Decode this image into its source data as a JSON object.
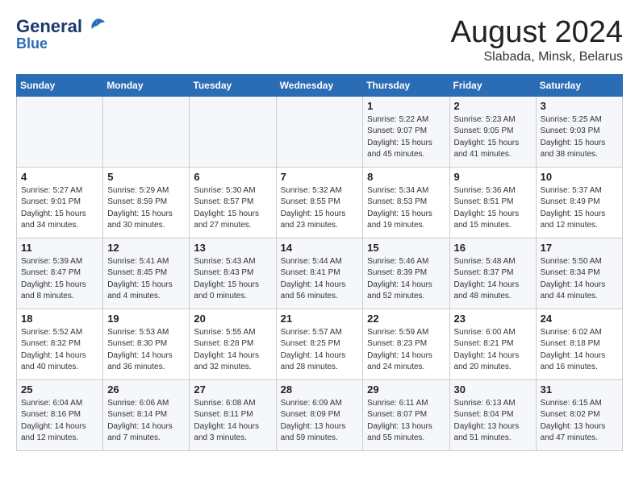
{
  "header": {
    "logo_line1": "General",
    "logo_line2": "Blue",
    "title": "August 2024",
    "subtitle": "Slabada, Minsk, Belarus"
  },
  "days_of_week": [
    "Sunday",
    "Monday",
    "Tuesday",
    "Wednesday",
    "Thursday",
    "Friday",
    "Saturday"
  ],
  "weeks": [
    [
      {
        "num": "",
        "detail": ""
      },
      {
        "num": "",
        "detail": ""
      },
      {
        "num": "",
        "detail": ""
      },
      {
        "num": "",
        "detail": ""
      },
      {
        "num": "1",
        "detail": "Sunrise: 5:22 AM\nSunset: 9:07 PM\nDaylight: 15 hours\nand 45 minutes."
      },
      {
        "num": "2",
        "detail": "Sunrise: 5:23 AM\nSunset: 9:05 PM\nDaylight: 15 hours\nand 41 minutes."
      },
      {
        "num": "3",
        "detail": "Sunrise: 5:25 AM\nSunset: 9:03 PM\nDaylight: 15 hours\nand 38 minutes."
      }
    ],
    [
      {
        "num": "4",
        "detail": "Sunrise: 5:27 AM\nSunset: 9:01 PM\nDaylight: 15 hours\nand 34 minutes."
      },
      {
        "num": "5",
        "detail": "Sunrise: 5:29 AM\nSunset: 8:59 PM\nDaylight: 15 hours\nand 30 minutes."
      },
      {
        "num": "6",
        "detail": "Sunrise: 5:30 AM\nSunset: 8:57 PM\nDaylight: 15 hours\nand 27 minutes."
      },
      {
        "num": "7",
        "detail": "Sunrise: 5:32 AM\nSunset: 8:55 PM\nDaylight: 15 hours\nand 23 minutes."
      },
      {
        "num": "8",
        "detail": "Sunrise: 5:34 AM\nSunset: 8:53 PM\nDaylight: 15 hours\nand 19 minutes."
      },
      {
        "num": "9",
        "detail": "Sunrise: 5:36 AM\nSunset: 8:51 PM\nDaylight: 15 hours\nand 15 minutes."
      },
      {
        "num": "10",
        "detail": "Sunrise: 5:37 AM\nSunset: 8:49 PM\nDaylight: 15 hours\nand 12 minutes."
      }
    ],
    [
      {
        "num": "11",
        "detail": "Sunrise: 5:39 AM\nSunset: 8:47 PM\nDaylight: 15 hours\nand 8 minutes."
      },
      {
        "num": "12",
        "detail": "Sunrise: 5:41 AM\nSunset: 8:45 PM\nDaylight: 15 hours\nand 4 minutes."
      },
      {
        "num": "13",
        "detail": "Sunrise: 5:43 AM\nSunset: 8:43 PM\nDaylight: 15 hours\nand 0 minutes."
      },
      {
        "num": "14",
        "detail": "Sunrise: 5:44 AM\nSunset: 8:41 PM\nDaylight: 14 hours\nand 56 minutes."
      },
      {
        "num": "15",
        "detail": "Sunrise: 5:46 AM\nSunset: 8:39 PM\nDaylight: 14 hours\nand 52 minutes."
      },
      {
        "num": "16",
        "detail": "Sunrise: 5:48 AM\nSunset: 8:37 PM\nDaylight: 14 hours\nand 48 minutes."
      },
      {
        "num": "17",
        "detail": "Sunrise: 5:50 AM\nSunset: 8:34 PM\nDaylight: 14 hours\nand 44 minutes."
      }
    ],
    [
      {
        "num": "18",
        "detail": "Sunrise: 5:52 AM\nSunset: 8:32 PM\nDaylight: 14 hours\nand 40 minutes."
      },
      {
        "num": "19",
        "detail": "Sunrise: 5:53 AM\nSunset: 8:30 PM\nDaylight: 14 hours\nand 36 minutes."
      },
      {
        "num": "20",
        "detail": "Sunrise: 5:55 AM\nSunset: 8:28 PM\nDaylight: 14 hours\nand 32 minutes."
      },
      {
        "num": "21",
        "detail": "Sunrise: 5:57 AM\nSunset: 8:25 PM\nDaylight: 14 hours\nand 28 minutes."
      },
      {
        "num": "22",
        "detail": "Sunrise: 5:59 AM\nSunset: 8:23 PM\nDaylight: 14 hours\nand 24 minutes."
      },
      {
        "num": "23",
        "detail": "Sunrise: 6:00 AM\nSunset: 8:21 PM\nDaylight: 14 hours\nand 20 minutes."
      },
      {
        "num": "24",
        "detail": "Sunrise: 6:02 AM\nSunset: 8:18 PM\nDaylight: 14 hours\nand 16 minutes."
      }
    ],
    [
      {
        "num": "25",
        "detail": "Sunrise: 6:04 AM\nSunset: 8:16 PM\nDaylight: 14 hours\nand 12 minutes."
      },
      {
        "num": "26",
        "detail": "Sunrise: 6:06 AM\nSunset: 8:14 PM\nDaylight: 14 hours\nand 7 minutes."
      },
      {
        "num": "27",
        "detail": "Sunrise: 6:08 AM\nSunset: 8:11 PM\nDaylight: 14 hours\nand 3 minutes."
      },
      {
        "num": "28",
        "detail": "Sunrise: 6:09 AM\nSunset: 8:09 PM\nDaylight: 13 hours\nand 59 minutes."
      },
      {
        "num": "29",
        "detail": "Sunrise: 6:11 AM\nSunset: 8:07 PM\nDaylight: 13 hours\nand 55 minutes."
      },
      {
        "num": "30",
        "detail": "Sunrise: 6:13 AM\nSunset: 8:04 PM\nDaylight: 13 hours\nand 51 minutes."
      },
      {
        "num": "31",
        "detail": "Sunrise: 6:15 AM\nSunset: 8:02 PM\nDaylight: 13 hours\nand 47 minutes."
      }
    ]
  ]
}
